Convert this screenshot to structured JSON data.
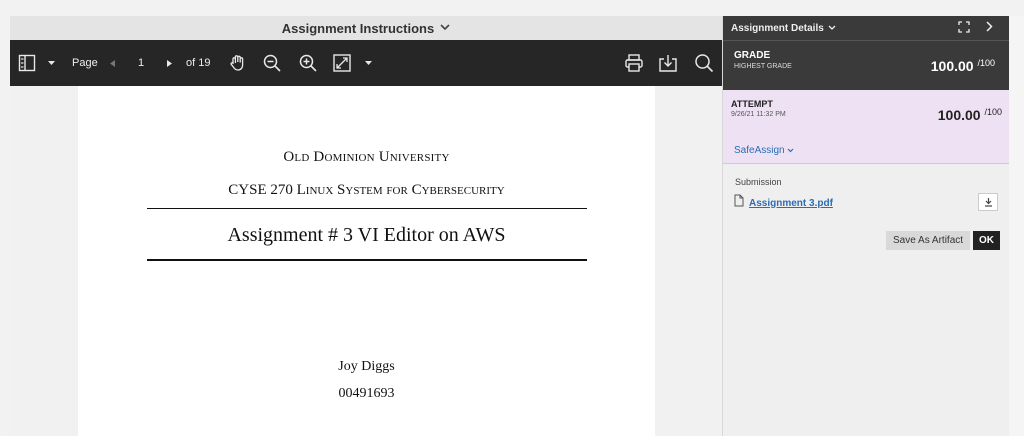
{
  "instructions": {
    "title": "Assignment Instructions"
  },
  "toolbar": {
    "page_label": "Page",
    "current_page": "1",
    "page_total": "of 19"
  },
  "document": {
    "university": "Old Dominion University",
    "course": "CYSE 270 Linux System for Cybersecurity",
    "assignment_title": "Assignment # 3 VI Editor on AWS",
    "author": "Joy Diggs",
    "student_id": "00491693"
  },
  "details": {
    "header": "Assignment Details",
    "grade": {
      "label": "GRADE",
      "sublabel": "HIGHEST GRADE",
      "value": "100.00",
      "max": "/100"
    },
    "attempt": {
      "label": "ATTEMPT",
      "timestamp": "9/26/21 11:32 PM",
      "value": "100.00",
      "max": "/100",
      "safeassign_label": "SafeAssign"
    },
    "submission": {
      "label": "Submission",
      "file_name": "Assignment 3.pdf",
      "save_artifact_label": "Save As Artifact",
      "ok_label": "OK"
    }
  },
  "colors": {
    "toolbar_bg": "#262626",
    "details_dark": "#3a3a3a",
    "attempt_bg": "#efe1f4",
    "link": "#2a6db5"
  }
}
